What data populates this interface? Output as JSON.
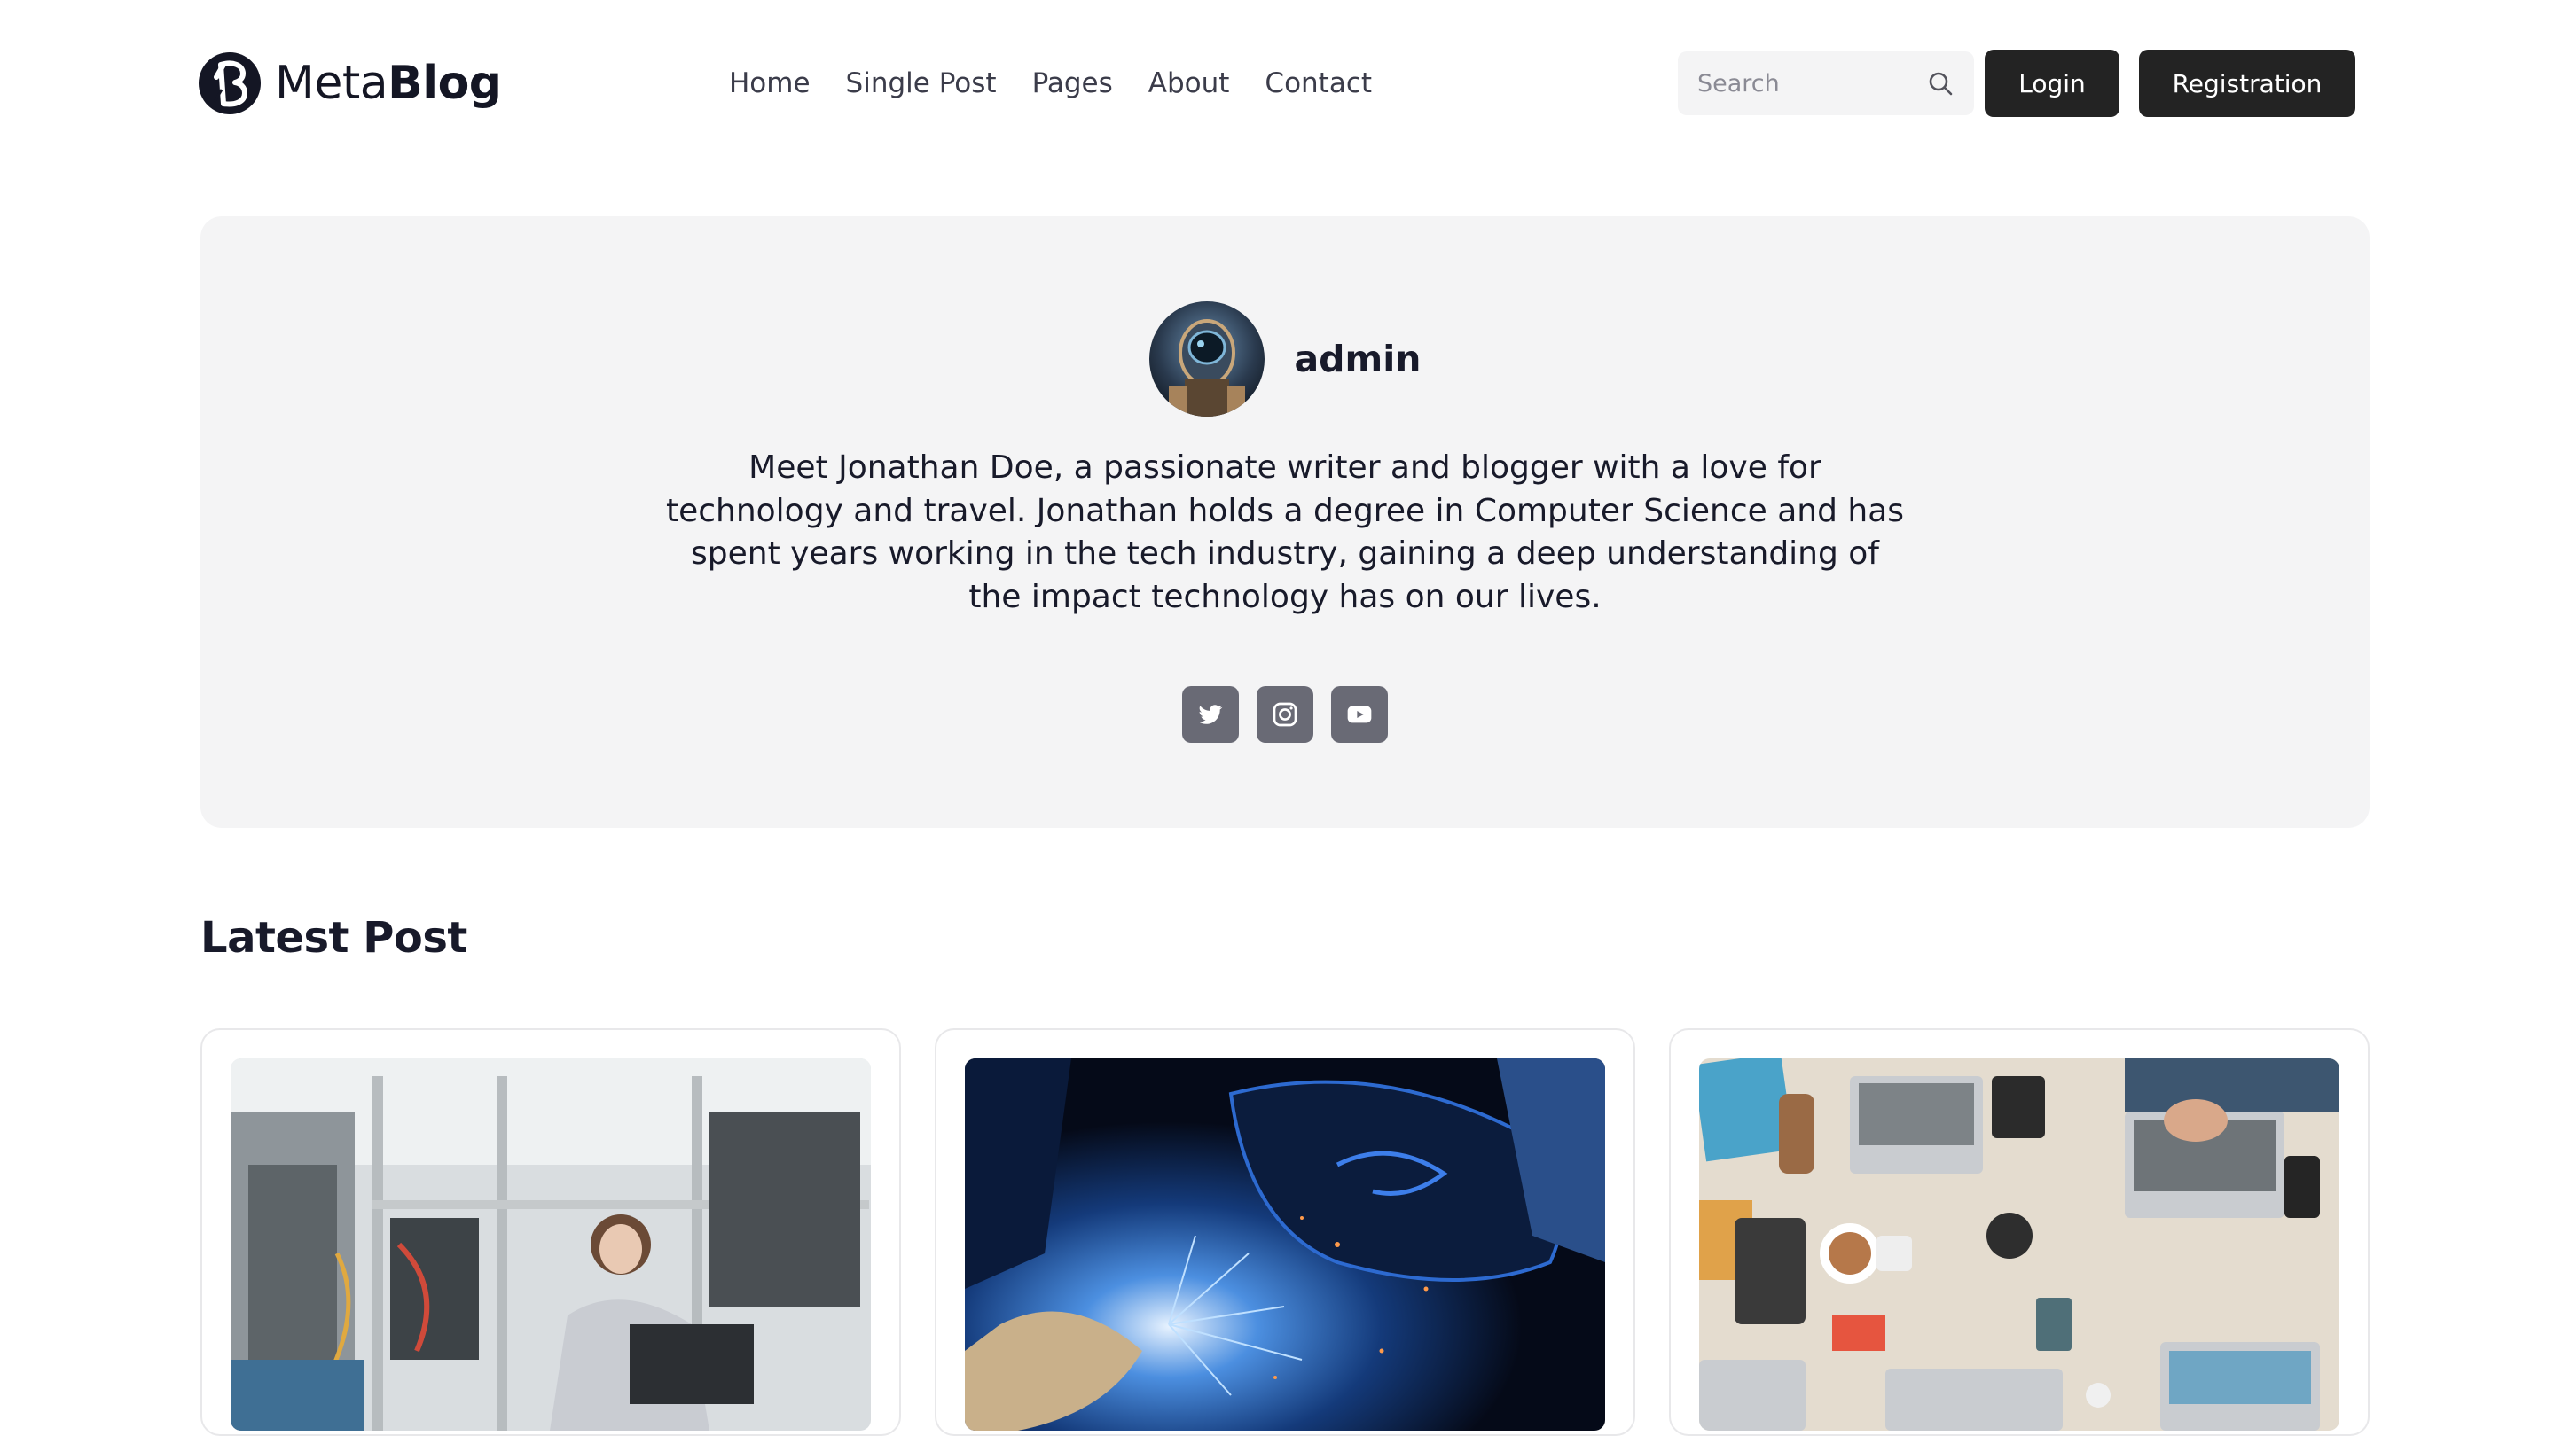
{
  "header": {
    "logo": {
      "thin": "Meta",
      "bold": "Blog",
      "icon": "blog-logo-icon"
    },
    "nav": [
      {
        "label": "Home"
      },
      {
        "label": "Single Post"
      },
      {
        "label": "Pages"
      },
      {
        "label": "About"
      },
      {
        "label": "Contact"
      }
    ],
    "search": {
      "placeholder": "Search",
      "icon": "search-icon"
    },
    "login_label": "Login",
    "register_label": "Registration"
  },
  "author": {
    "name": "admin",
    "bio": "Meet Jonathan Doe, a passionate writer and blogger with a love for technology and travel. Jonathan holds a degree in Computer Science and has spent years working in the tech industry, gaining a deep understanding of the impact technology has on our lives.",
    "socials": [
      {
        "icon": "twitter-icon"
      },
      {
        "icon": "instagram-icon"
      },
      {
        "icon": "youtube-icon"
      }
    ]
  },
  "latest": {
    "title": "Latest Post"
  },
  "colors": {
    "button_bg": "#232323",
    "card_bg": "#f4f4f5",
    "social_bg": "#696a75",
    "text": "#181a2a"
  }
}
